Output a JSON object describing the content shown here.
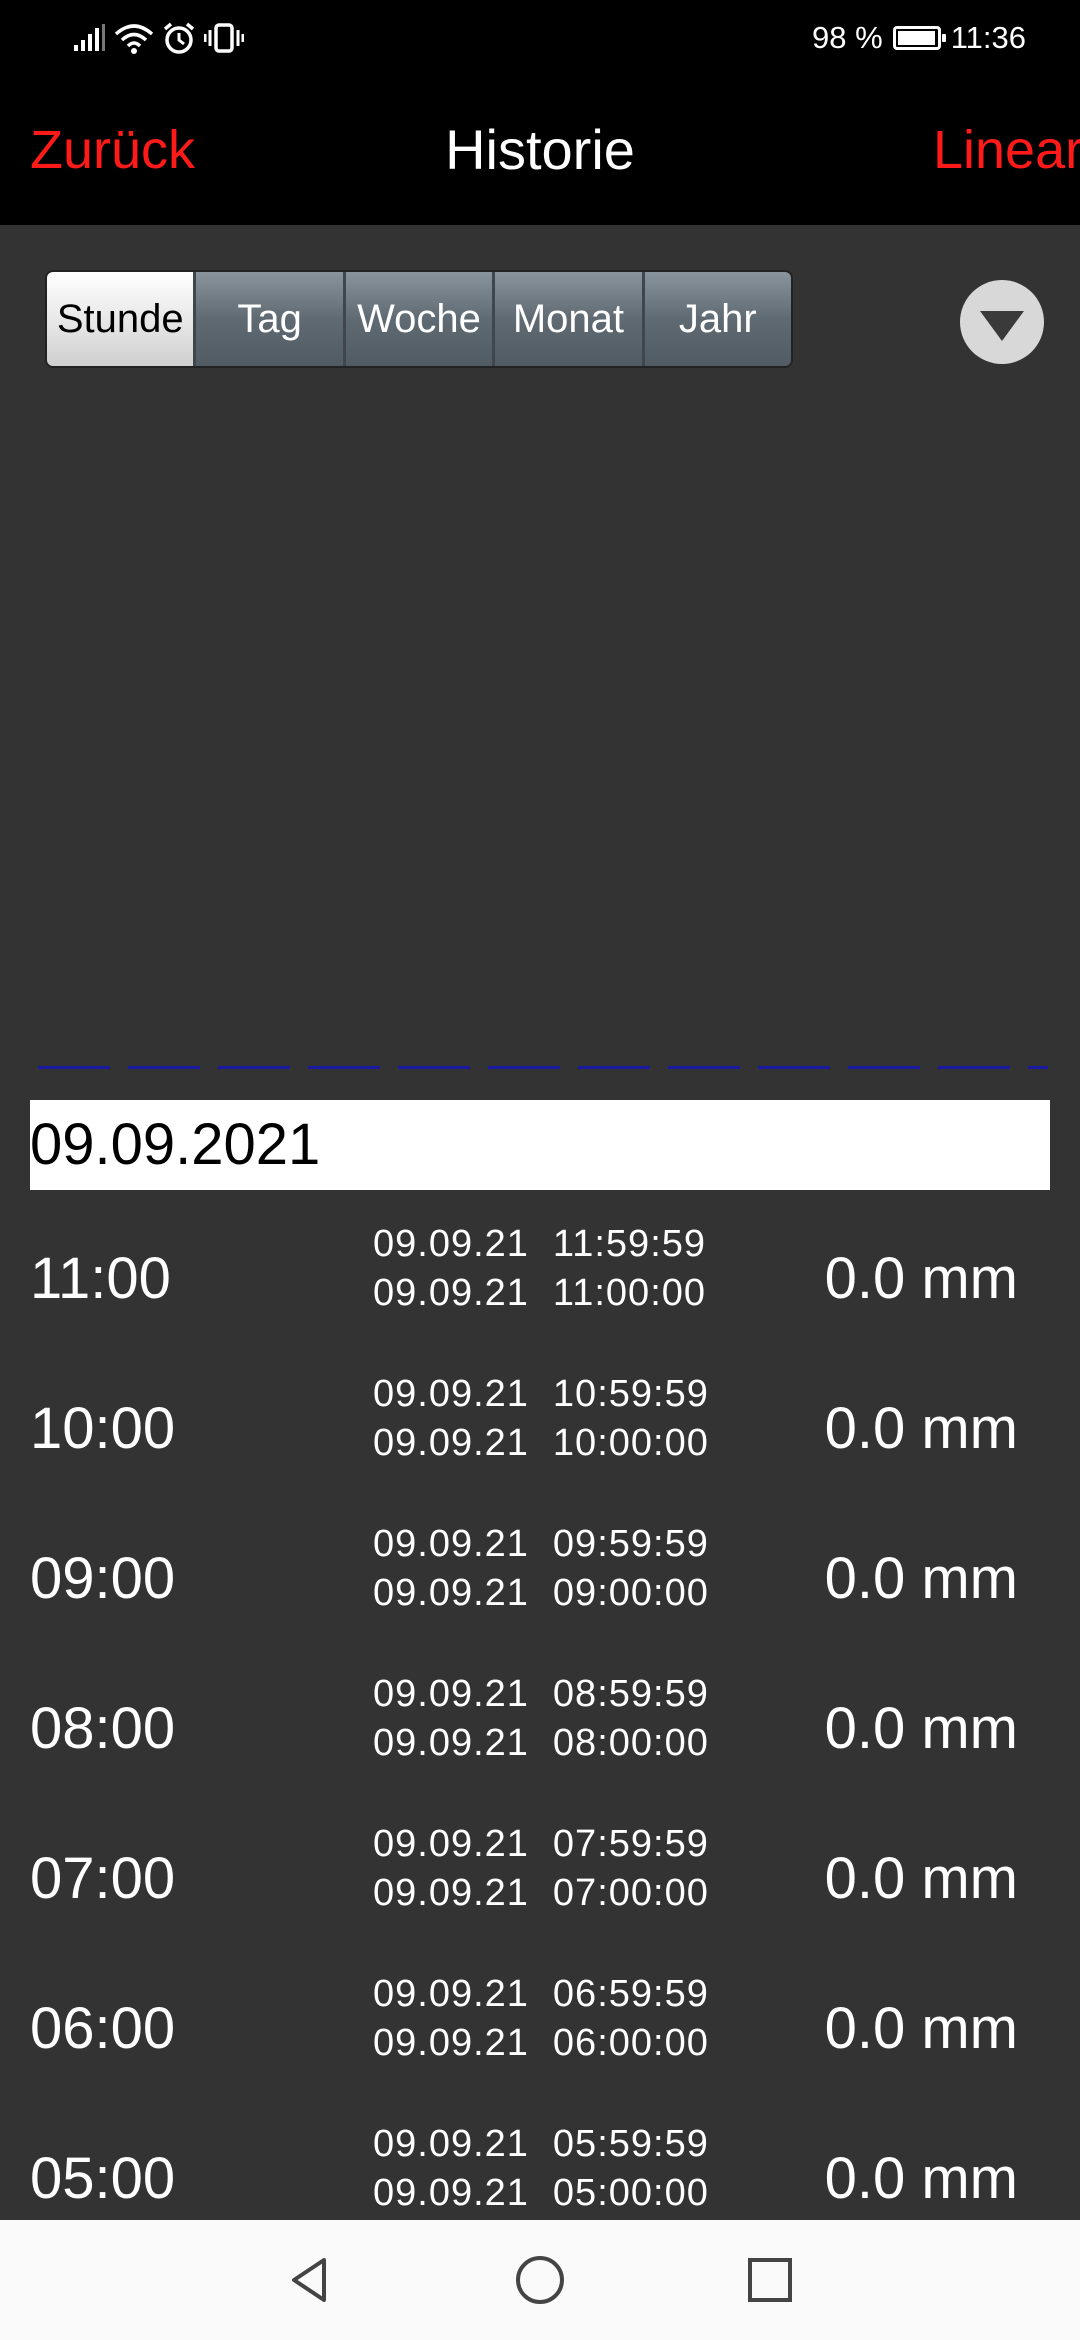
{
  "status_bar": {
    "battery_percent": "98 %",
    "battery_level": 0.98,
    "time": "11:36",
    "icons": [
      "signal-icon",
      "wifi-icon",
      "alarm-icon",
      "vibrate-icon"
    ]
  },
  "header": {
    "back_label": "Zurück",
    "title": "Historie",
    "right_label": "Linear"
  },
  "segments": {
    "items": [
      "Stunde",
      "Tag",
      "Woche",
      "Monat",
      "Jahr"
    ],
    "selected": "Stunde"
  },
  "dropdown_icon": "chevron-down-icon",
  "date_header": "09.09.2021",
  "rows": [
    {
      "hour": "11:00",
      "to_date": "09.09.21",
      "to_time": "11:59:59",
      "from_date": "09.09.21",
      "from_time": "11:00:00",
      "value": "0.0 mm"
    },
    {
      "hour": "10:00",
      "to_date": "09.09.21",
      "to_time": "10:59:59",
      "from_date": "09.09.21",
      "from_time": "10:00:00",
      "value": "0.0 mm"
    },
    {
      "hour": "09:00",
      "to_date": "09.09.21",
      "to_time": "09:59:59",
      "from_date": "09.09.21",
      "from_time": "09:00:00",
      "value": "0.0 mm"
    },
    {
      "hour": "08:00",
      "to_date": "09.09.21",
      "to_time": "08:59:59",
      "from_date": "09.09.21",
      "from_time": "08:00:00",
      "value": "0.0 mm"
    },
    {
      "hour": "07:00",
      "to_date": "09.09.21",
      "to_time": "07:59:59",
      "from_date": "09.09.21",
      "from_time": "07:00:00",
      "value": "0.0 mm"
    },
    {
      "hour": "06:00",
      "to_date": "09.09.21",
      "to_time": "06:59:59",
      "from_date": "09.09.21",
      "from_time": "06:00:00",
      "value": "0.0 mm"
    },
    {
      "hour": "05:00",
      "to_date": "09.09.21",
      "to_time": "05:59:59",
      "from_date": "09.09.21",
      "from_time": "05:00:00",
      "value": "0.0 mm"
    }
  ],
  "colors": {
    "accent": "#ff1a1a",
    "background": "#333333",
    "header_bg": "#000000",
    "chart_line": "#1a1aa0"
  },
  "nav": {
    "icons": [
      "back-icon",
      "home-icon",
      "recent-apps-icon"
    ]
  }
}
